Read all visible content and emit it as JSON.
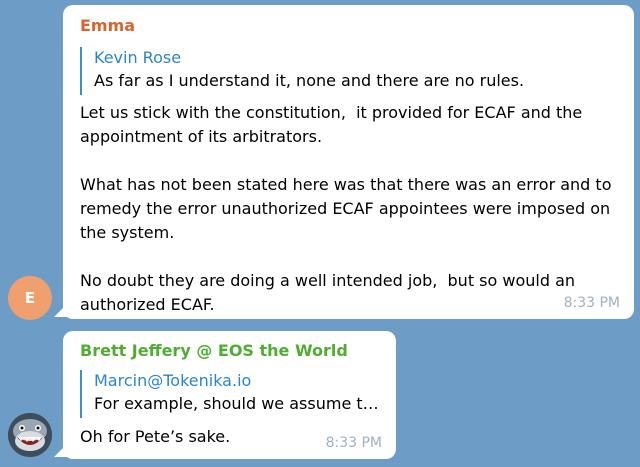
{
  "messages": [
    {
      "sender": "Emma",
      "sender_color": "#d9652e",
      "avatar_initial": "E",
      "avatar_color": "#f0a06f",
      "reply_to": {
        "name": "Kevin Rose",
        "text": "As far as I understand it, none and there are no rules."
      },
      "text": "Let us stick with the constitution,  it provided for ECAF and the appointment of its arbitrators.\n\nWhat has not been stated here was that there was an error and to remedy the error unauthorized ECAF appointees were imposed on the system.\n\nNo doubt they are doing a well intended job,  but so would an authorized ECAF.",
      "time": "8:33 PM"
    },
    {
      "sender": "Brett Jeffery @ EOS the World",
      "sender_color": "#4fae32",
      "avatar_icon": "shark-avatar-icon",
      "reply_to": {
        "name": "Marcin@Tokenika.io",
        "text": "For example, should we assume t…"
      },
      "text": "Oh for Pete’s sake.",
      "time": "8:33 PM"
    }
  ]
}
